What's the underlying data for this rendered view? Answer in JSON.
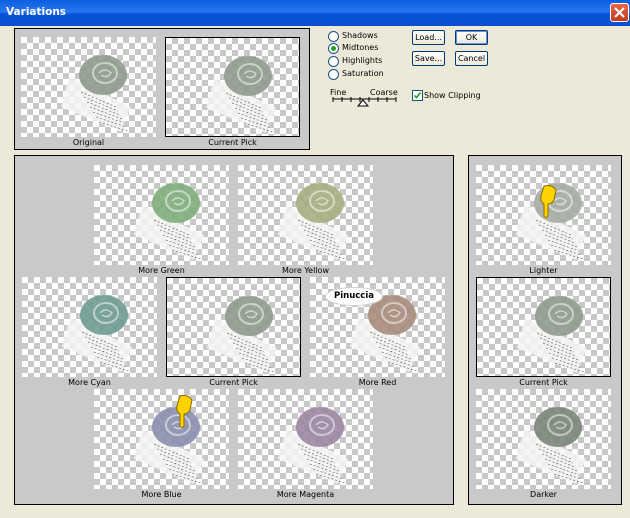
{
  "window": {
    "title": "Variations"
  },
  "top_previews": [
    {
      "caption": "Original"
    },
    {
      "caption": "Current Pick"
    }
  ],
  "modes": [
    {
      "label": "Shadows",
      "selected": false
    },
    {
      "label": "Midtones",
      "selected": true
    },
    {
      "label": "Highlights",
      "selected": false
    },
    {
      "label": "Saturation",
      "selected": false
    }
  ],
  "slider": {
    "fine_label": "Fine",
    "coarse_label": "Coarse",
    "position": 0.5
  },
  "buttons": {
    "load": "Load...",
    "ok": "OK",
    "save": "Save...",
    "cancel": "Cancel"
  },
  "show_clipping": {
    "label": "Show Clipping",
    "checked": true
  },
  "color_variations": [
    {
      "caption": "More Green"
    },
    {
      "caption": "More Yellow"
    },
    {
      "caption": "More Cyan"
    },
    {
      "caption": "Current Pick"
    },
    {
      "caption": "More Red"
    },
    {
      "caption": "More Blue"
    },
    {
      "caption": "More Magenta"
    }
  ],
  "brightness_variations": [
    {
      "caption": "Lighter"
    },
    {
      "caption": "Current Pick"
    },
    {
      "caption": "Darker"
    }
  ],
  "watermark": {
    "text": "Pinuccia"
  },
  "colors": {
    "titlebar": "#0a5fe0",
    "panel": "#c9c9c9",
    "dialog": "#ece9d8",
    "radio_selected": "#21a121"
  }
}
